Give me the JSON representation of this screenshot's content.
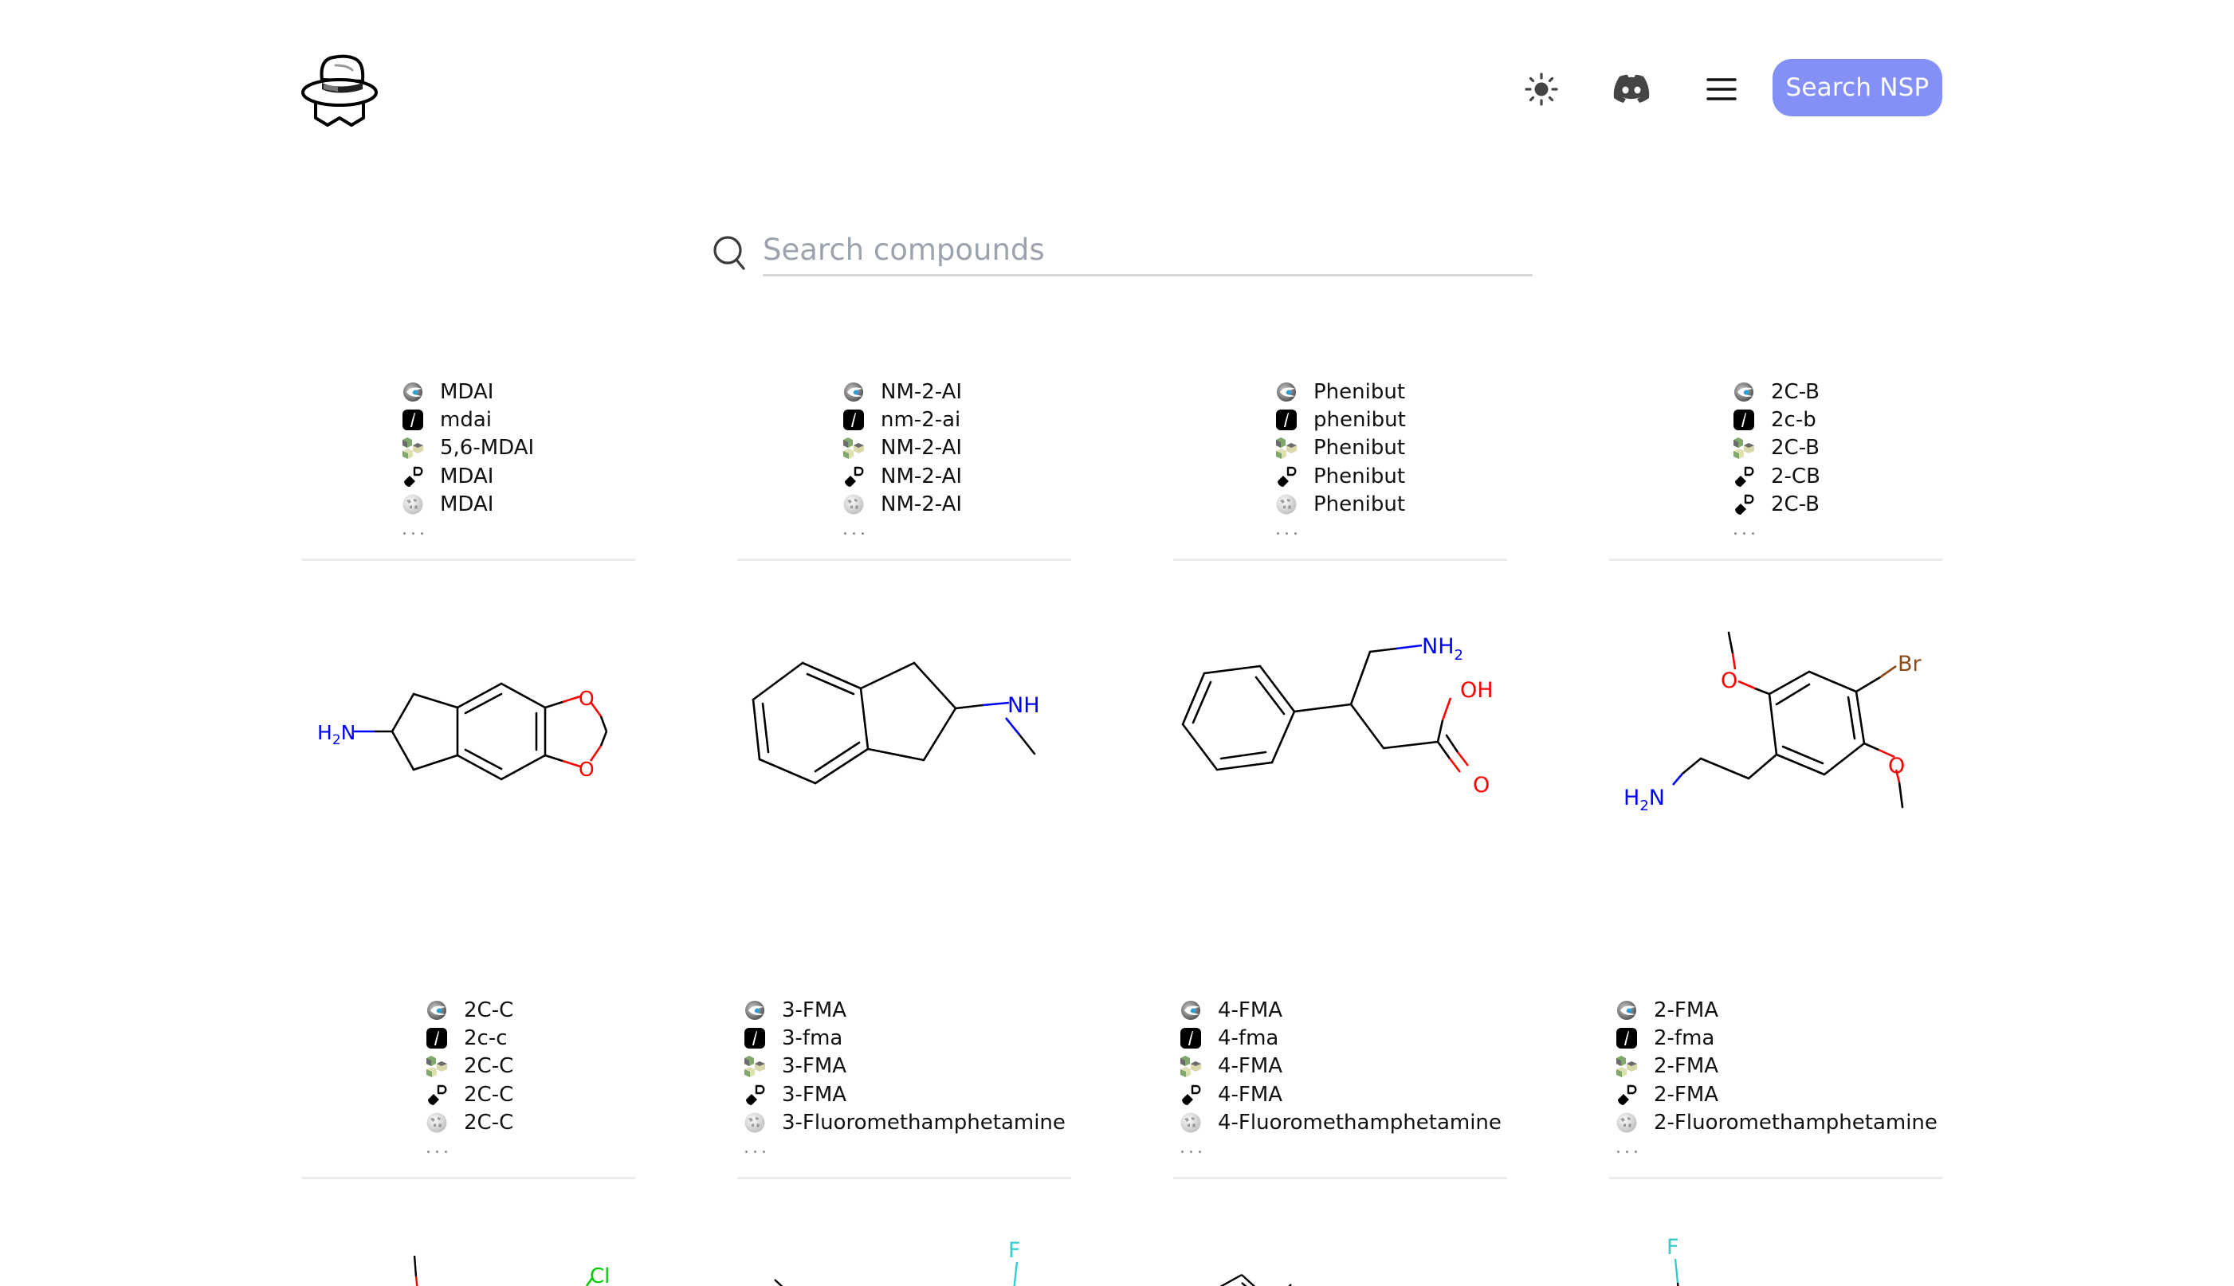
{
  "header": {
    "logo_alt": "incognito-hat-logo",
    "theme_toggle": "sun-icon",
    "discord": "discord-icon",
    "menu": "hamburger-menu-icon",
    "search_nsp_label": "Search NSP",
    "accent_color": "#8490f7"
  },
  "search": {
    "placeholder": "Search compounds",
    "value": ""
  },
  "sources": [
    {
      "id": "psychonautwiki",
      "icon": "eye-logo-icon"
    },
    {
      "id": "tripsit",
      "icon": "tripsit-icon"
    },
    {
      "id": "isomerdesign",
      "icon": "cubes-icon"
    },
    {
      "id": "drugsdata",
      "icon": "pill-icon"
    },
    {
      "id": "wikipedia",
      "icon": "wikipedia-globe-icon"
    }
  ],
  "more_label": "...",
  "compounds": [
    {
      "names": [
        {
          "icon": "eye-logo-icon",
          "text": "MDAI"
        },
        {
          "icon": "tripsit-icon",
          "text": "mdai"
        },
        {
          "icon": "cubes-icon",
          "text": "5,6-MDAI"
        },
        {
          "icon": "pill-icon",
          "text": "MDAI"
        },
        {
          "icon": "wikipedia-globe-icon",
          "text": "MDAI"
        }
      ],
      "structure": "MDAI",
      "atom_labels": [
        "H2N",
        "O",
        "O"
      ]
    },
    {
      "names": [
        {
          "icon": "eye-logo-icon",
          "text": "NM-2-AI"
        },
        {
          "icon": "tripsit-icon",
          "text": "nm-2-ai"
        },
        {
          "icon": "cubes-icon",
          "text": "NM-2-AI"
        },
        {
          "icon": "pill-icon",
          "text": "NM-2-AI"
        },
        {
          "icon": "wikipedia-globe-icon",
          "text": "NM-2-AI"
        }
      ],
      "structure": "NM-2-AI",
      "atom_labels": [
        "NH"
      ]
    },
    {
      "names": [
        {
          "icon": "eye-logo-icon",
          "text": "Phenibut"
        },
        {
          "icon": "tripsit-icon",
          "text": "phenibut"
        },
        {
          "icon": "cubes-icon",
          "text": "Phenibut"
        },
        {
          "icon": "pill-icon",
          "text": "Phenibut"
        },
        {
          "icon": "wikipedia-globe-icon",
          "text": "Phenibut"
        }
      ],
      "structure": "Phenibut",
      "atom_labels": [
        "NH2",
        "OH",
        "O"
      ]
    },
    {
      "names": [
        {
          "icon": "eye-logo-icon",
          "text": "2C-B"
        },
        {
          "icon": "tripsit-icon",
          "text": "2c-b"
        },
        {
          "icon": "cubes-icon",
          "text": "2C-B"
        },
        {
          "icon": "pill-icon",
          "text": "2-CB"
        },
        {
          "icon": "pill-icon",
          "text": "2C-B"
        }
      ],
      "structure": "2C-B",
      "atom_labels": [
        "Br",
        "O",
        "O",
        "H2N"
      ]
    },
    {
      "names": [
        {
          "icon": "eye-logo-icon",
          "text": "2C-C"
        },
        {
          "icon": "tripsit-icon",
          "text": "2c-c"
        },
        {
          "icon": "cubes-icon",
          "text": "2C-C"
        },
        {
          "icon": "pill-icon",
          "text": "2C-C"
        },
        {
          "icon": "wikipedia-globe-icon",
          "text": "2C-C"
        }
      ],
      "structure": "2C-C",
      "atom_labels": [
        "Cl"
      ]
    },
    {
      "names": [
        {
          "icon": "eye-logo-icon",
          "text": "3-FMA"
        },
        {
          "icon": "tripsit-icon",
          "text": "3-fma"
        },
        {
          "icon": "cubes-icon",
          "text": "3-FMA"
        },
        {
          "icon": "pill-icon",
          "text": "3-FMA"
        },
        {
          "icon": "wikipedia-globe-icon",
          "text": "3-Fluoromethamphetamine"
        }
      ],
      "structure": "3-FMA",
      "atom_labels": [
        "F"
      ]
    },
    {
      "names": [
        {
          "icon": "eye-logo-icon",
          "text": "4-FMA"
        },
        {
          "icon": "tripsit-icon",
          "text": "4-fma"
        },
        {
          "icon": "cubes-icon",
          "text": "4-FMA"
        },
        {
          "icon": "pill-icon",
          "text": "4-FMA"
        },
        {
          "icon": "wikipedia-globe-icon",
          "text": "4-Fluoromethamphetamine"
        }
      ],
      "structure": "4-FMA",
      "atom_labels": []
    },
    {
      "names": [
        {
          "icon": "eye-logo-icon",
          "text": "2-FMA"
        },
        {
          "icon": "tripsit-icon",
          "text": "2-fma"
        },
        {
          "icon": "cubes-icon",
          "text": "2-FMA"
        },
        {
          "icon": "pill-icon",
          "text": "2-FMA"
        },
        {
          "icon": "wikipedia-globe-icon",
          "text": "2-Fluoromethamphetamine"
        }
      ],
      "structure": "2-FMA",
      "atom_labels": [
        "F"
      ]
    }
  ],
  "atom_colors": {
    "N": "#0000ff",
    "O": "#ff0000",
    "Br": "#8a4a1a",
    "Cl": "#00cc00",
    "F": "#33cccc"
  }
}
